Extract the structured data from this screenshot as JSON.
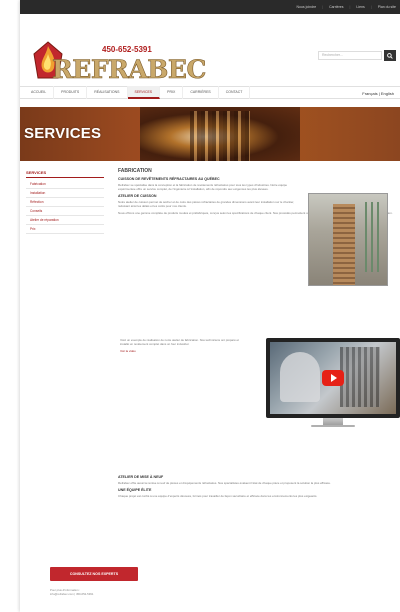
{
  "header": {
    "phone": "450-652-5391",
    "logo_text": "REFRABEC",
    "search_placeholder": "Rechercher...",
    "topbar": [
      "Nous joindre",
      "Carrières",
      "Liens",
      "Plan du site"
    ]
  },
  "nav": {
    "items": [
      "Accueil",
      "Produits",
      "Réalisations",
      "Services",
      "Prix",
      "Carrières",
      "Contact"
    ],
    "active_index": 3,
    "lang": "Français | English"
  },
  "banner": {
    "title": "SERVICES"
  },
  "sidebar": {
    "title": "SERVICES",
    "items": [
      "Fabrication",
      "Installation",
      "Réfection",
      "Conseils",
      "Atelier de réparation",
      "Prix"
    ]
  },
  "main": {
    "section_title": "FABRICATION",
    "subtitle1": "CUISSON DE REVÊTEMENTS RÉFRACTAIRES AU QUÉBEC",
    "p1": "Refrabec se spécialise dans la conception et la fabrication de revêtements réfractaires pour tous les types d'industries. Notre équipe expérimentée offre un service complet, de l'ingénierie à l'installation, afin de répondre aux exigences les plus élevées.",
    "subtitle2": "ATELIER DE CUISSON",
    "p2": "Notre atelier de cuisson permet de sécher et de cuire des pièces réfractaires de grandes dimensions avant leur installation sur le chantier, réduisant ainsi les délais et les coûts pour nos clients.",
    "p3": "Nous offrons une gamme complète de produits moulés et préfabriqués, conçus selon les spécifications de chaque client. Nos procédés permettent un contrôle rigoureux de la qualité à chaque étape de la production.",
    "video_text": "Voici un exemple de réalisation de notre atelier de fabrication. Nos techniciens ont préparé et installé un revêtement complet dans un four industriel.",
    "video_link": "Voir la vidéo",
    "subtitle3": "ATELIER DE MISE À NEUF",
    "p4": "Refrabec offre aussi la remise à neuf de pièces et d'équipements réfractaires. Nos spécialistes évaluent l'état de chaque pièce et proposent la solution la plus efficace.",
    "subtitle4": "UNE ÉQUIPE ÉLITE",
    "p5": "Chaque projet est confié à une équipe d'experts dévoués, formés pour travailler de façon sécuritaire et efficace dans les environnements les plus exigeants.",
    "cta": "CONSULTEZ NOS EXPERTS",
    "footnote1": "Pour plus d'information :",
    "footnote2": "info@refrabec.com | 450-652-5391"
  }
}
